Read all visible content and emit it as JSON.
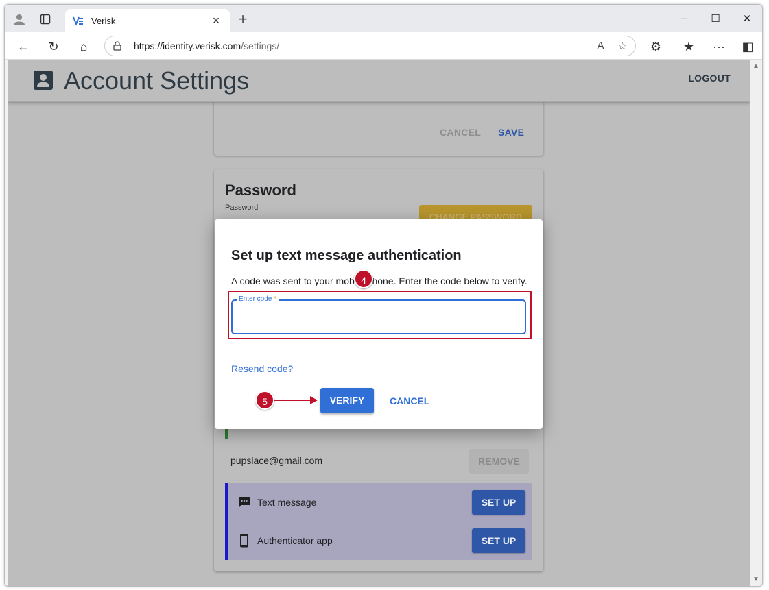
{
  "browser": {
    "tab_title": "Verisk",
    "tab_close": "×",
    "new_tab": "+",
    "url_host": "https://identity.verisk.com",
    "url_path": "/settings/",
    "controls": {
      "minimize": "─",
      "maximize": "☐",
      "close": "✕"
    },
    "icons": {
      "back": "←",
      "reload": "↻",
      "home": "⌂",
      "read_aloud": "A",
      "favorite": "☆",
      "extensions": "⚙",
      "favorites": "★",
      "more": "···",
      "sidebar": "◧"
    }
  },
  "header": {
    "title": "Account Settings",
    "logout_label": "LOGOUT"
  },
  "top_card": {
    "cancel_label": "CANCEL",
    "save_label": "SAVE"
  },
  "password_card": {
    "title": "Password",
    "subtitle": "Password",
    "change_label": "CHANGE PASSWORD",
    "email": "pupslace@gmail.com",
    "remove_label": "REMOVE",
    "methods": [
      {
        "label": "Text message",
        "button": "SET UP",
        "icon": "sms-icon"
      },
      {
        "label": "Authenticator app",
        "button": "SET UP",
        "icon": "phone-icon"
      }
    ]
  },
  "dialog": {
    "title": "Set up text message authentication",
    "message": "A code was sent to your mobile phone. Enter the code below to verify.",
    "code_label": "Enter code",
    "required_mark": "*",
    "code_value": "",
    "resend_label": "Resend code?",
    "verify_label": "VERIFY",
    "cancel_label": "CANCEL"
  },
  "annotations": {
    "step4": "4",
    "step5": "5"
  },
  "colors": {
    "accent_blue": "#2f6fd6",
    "annotation_red": "#c0112b",
    "setup_button": "#2f57a8",
    "mfa_border": "#1a19c9"
  }
}
